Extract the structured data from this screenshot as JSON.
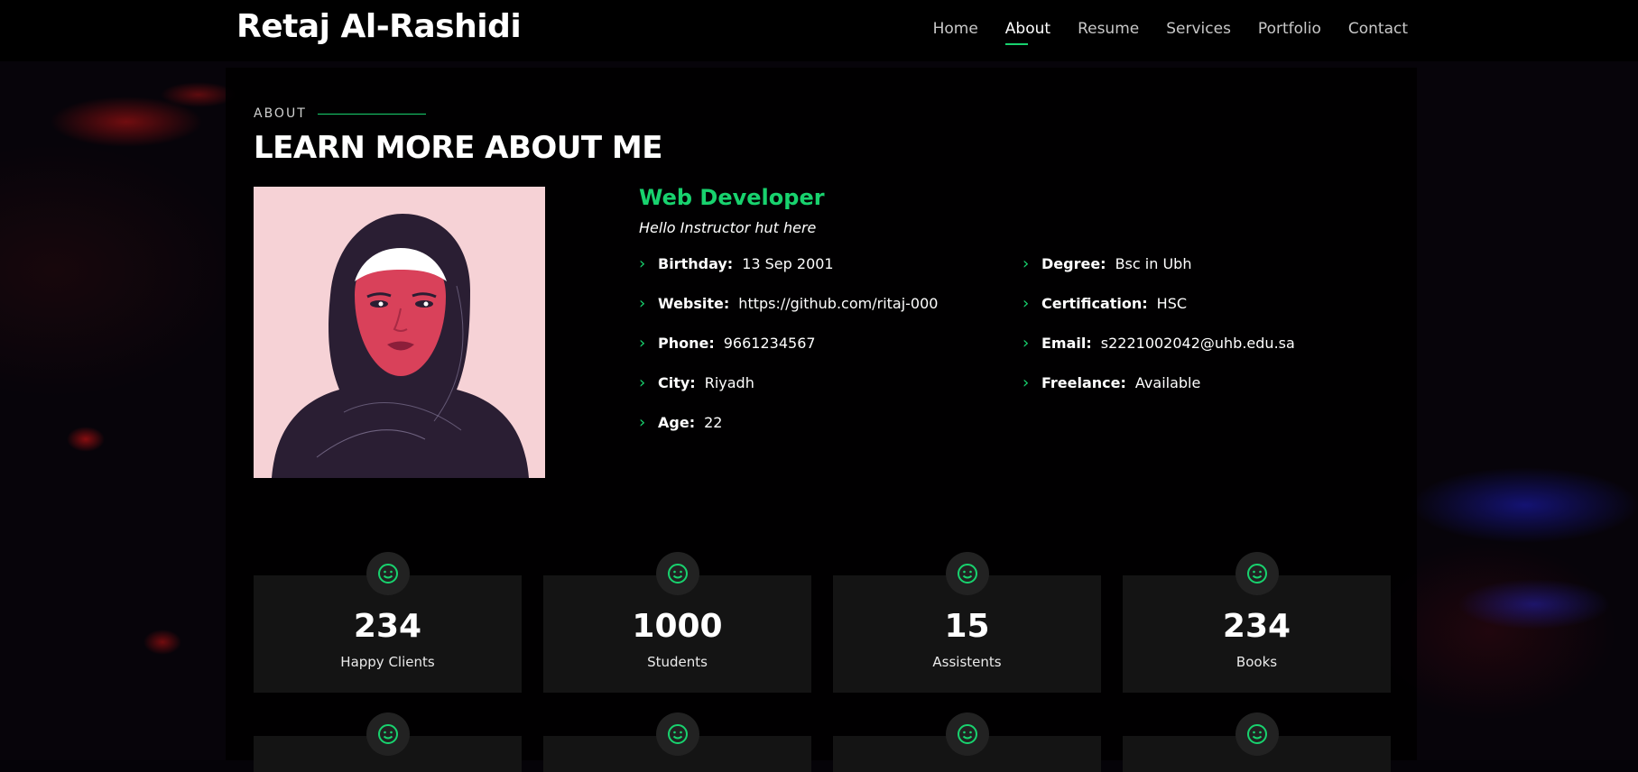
{
  "header": {
    "logo": "Retaj Al-Rashidi",
    "nav": [
      "Home",
      "About",
      "Resume",
      "Services",
      "Portfolio",
      "Contact"
    ],
    "active": "About"
  },
  "about": {
    "eyebrow": "ABOUT",
    "title": "LEARN MORE ABOUT ME",
    "role": "Web Developer",
    "tagline": "Hello Instructor hut here",
    "left": [
      {
        "label": "Birthday:",
        "value": "13 Sep 2001"
      },
      {
        "label": "Website:",
        "value": "https://github.com/ritaj-000"
      },
      {
        "label": "Phone:",
        "value": "9661234567"
      },
      {
        "label": "City:",
        "value": "Riyadh"
      },
      {
        "label": "Age:",
        "value": "22"
      }
    ],
    "right": [
      {
        "label": "Degree:",
        "value": "Bsc in Ubh"
      },
      {
        "label": "Certification:",
        "value": "HSC"
      },
      {
        "label": "Email:",
        "value": "s2221002042@uhb.edu.sa"
      },
      {
        "label": "Freelance:",
        "value": "Available"
      }
    ]
  },
  "stats": [
    {
      "num": "234",
      "label": "Happy Clients"
    },
    {
      "num": "1000",
      "label": "Students"
    },
    {
      "num": "15",
      "label": "Assistents"
    },
    {
      "num": "234",
      "label": "Books"
    }
  ],
  "colors": {
    "accent": "#18d26e",
    "card": "#141414"
  },
  "icons": {
    "stat": "smile-icon",
    "bullet": "chevron-right-icon"
  }
}
